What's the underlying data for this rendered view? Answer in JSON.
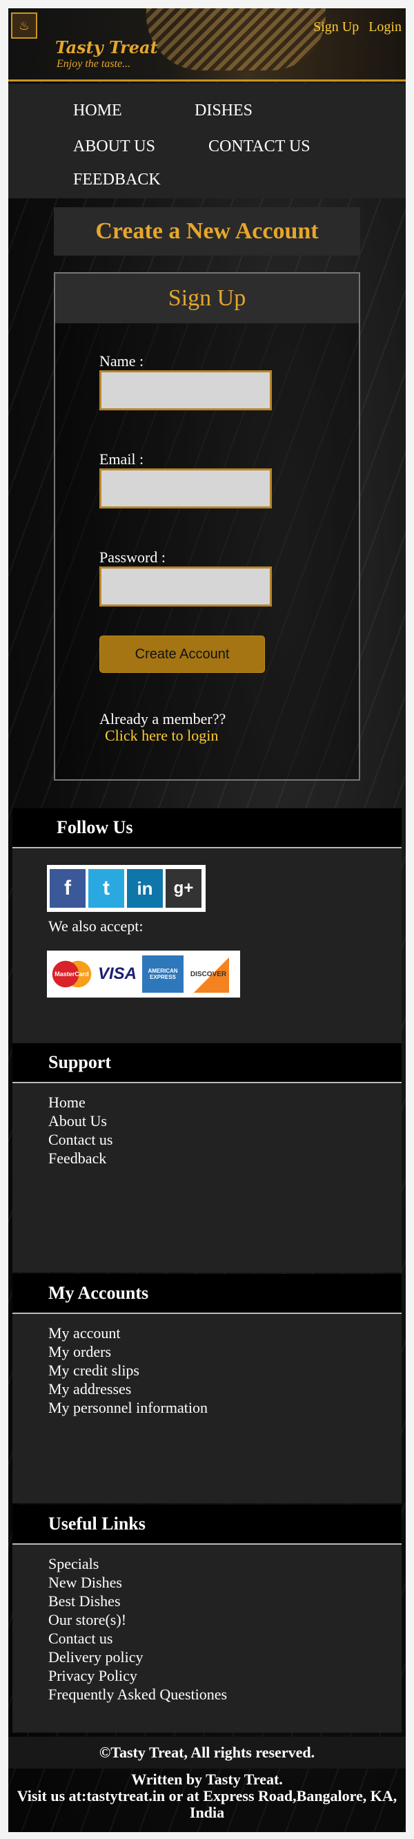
{
  "header": {
    "brand": "Tasty Treat",
    "tagline": "Enjoy the taste...",
    "signup_link": "Sign Up",
    "login_link": "Login"
  },
  "nav": {
    "home": "HOME",
    "dishes": "DISHES",
    "about": "ABOUT US",
    "contact": "CONTACT US",
    "feedback": "FEEDBACK"
  },
  "page": {
    "title": "Create a New Account"
  },
  "form": {
    "heading": "Sign Up",
    "name_label": "Name :",
    "email_label": "Email :",
    "password_label": "Password :",
    "submit_label": "Create Account",
    "already_text": "Already a member??",
    "login_link": "Click here to login"
  },
  "follow": {
    "heading": "Follow Us",
    "accept_text": "We also accept:",
    "social_icons": [
      "facebook-icon",
      "twitter-icon",
      "linkedin-icon",
      "google-plus-icon"
    ],
    "cards": [
      "MasterCard",
      "VISA",
      "AMERICAN EXPRESS",
      "DISCOVER"
    ]
  },
  "support": {
    "heading": "Support",
    "items": [
      "Home",
      "About Us",
      "Contact us",
      "Feedback"
    ]
  },
  "accounts": {
    "heading": "My Accounts",
    "items": [
      "My account",
      "My orders",
      "My credit slips",
      "My addresses",
      "My personnel information"
    ]
  },
  "useful": {
    "heading": "Useful Links",
    "items": [
      "Specials",
      "New Dishes",
      "Best Dishes",
      "Our store(s)!",
      "Contact us",
      "Delivery policy",
      "Privacy Policy",
      "Frequently Asked Questiones"
    ]
  },
  "footer": {
    "copyright": "©Tasty Treat, All rights reserved.",
    "written": "Written by Tasty Treat.",
    "visit": "Visit us at:tastytreat.in or at Express Road,Bangalore, KA, India"
  },
  "colors": {
    "accent": "#e6a72c",
    "link": "#ffcc33",
    "button": "#a47512"
  }
}
